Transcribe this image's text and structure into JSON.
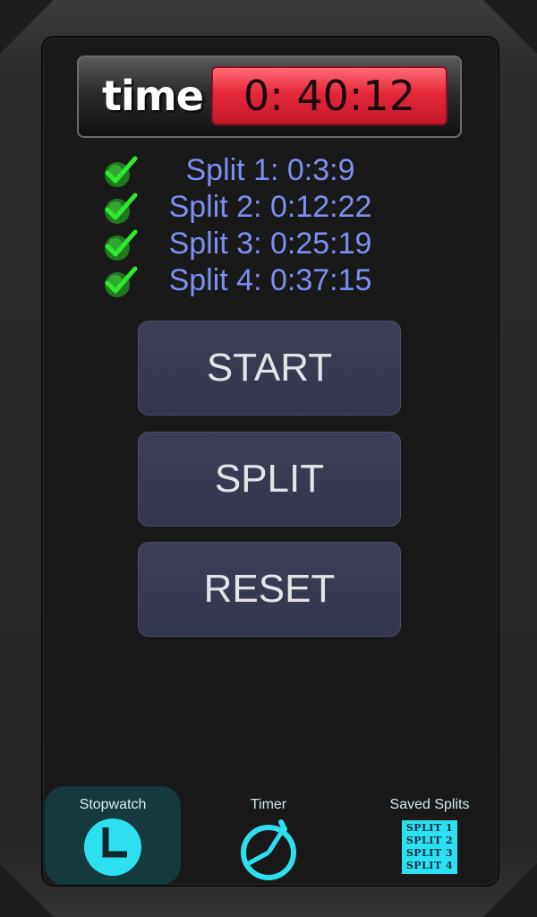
{
  "header": {
    "time_label": "time",
    "time_value": "0: 40:12"
  },
  "splits": [
    {
      "label": "Split 1: 0:3:9"
    },
    {
      "label": "Split 2: 0:12:22"
    },
    {
      "label": "Split 3: 0:25:19"
    },
    {
      "label": "Split 4: 0:37:15"
    }
  ],
  "buttons": {
    "start": "START",
    "split": "SPLIT",
    "reset": "RESET"
  },
  "tabs": {
    "stopwatch": "Stopwatch",
    "timer": "Timer",
    "saved_splits": "Saved Splits",
    "saved_icon_lines": [
      "SPLIT 1",
      "SPLIT 2",
      "SPLIT 3",
      "SPLIT 4"
    ],
    "active": "stopwatch"
  },
  "colors": {
    "split_text": "#7d8ff0",
    "time_display": "#e5283a",
    "tab_icon": "#2de0f0",
    "active_tab_bg": "#143a3e"
  }
}
